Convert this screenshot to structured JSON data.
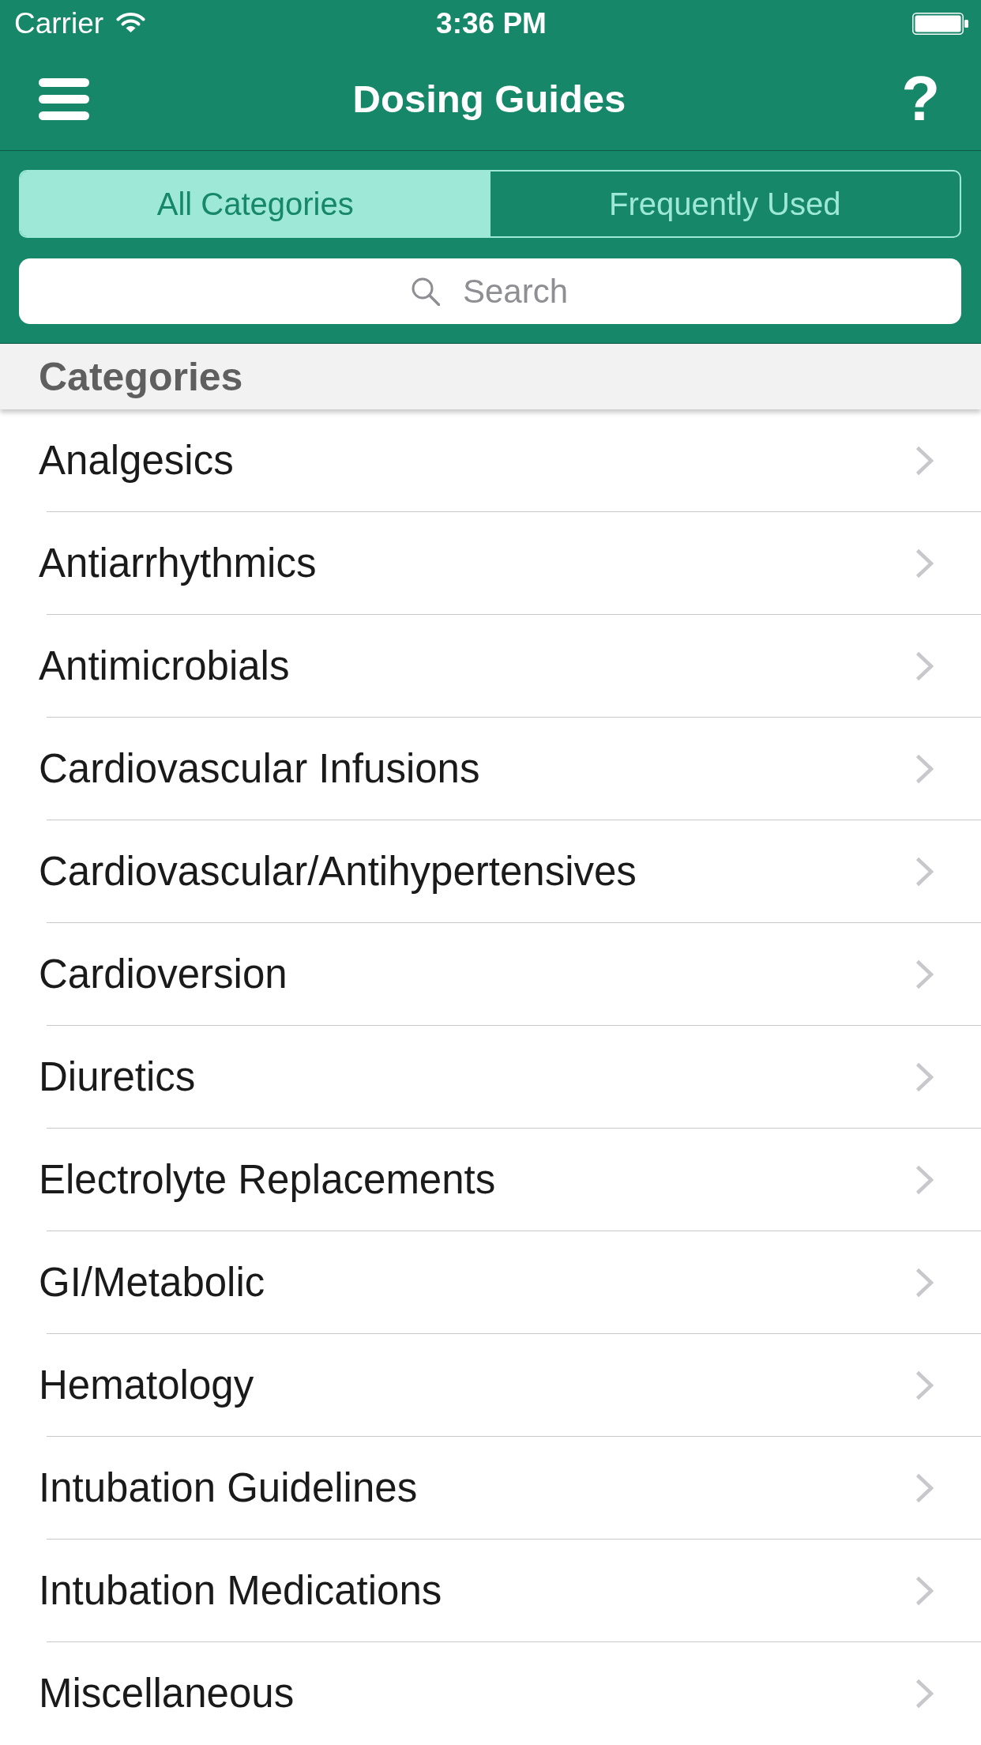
{
  "status_bar": {
    "carrier": "Carrier",
    "time": "3:36 PM"
  },
  "nav_bar": {
    "title": "Dosing Guides",
    "help_button": "?"
  },
  "tabs": [
    {
      "label": "All Categories",
      "selected": true
    },
    {
      "label": "Frequently Used",
      "selected": false
    }
  ],
  "search": {
    "placeholder": "Search"
  },
  "section": {
    "title": "Categories"
  },
  "categories": [
    "Analgesics",
    "Antiarrhythmics",
    "Antimicrobials",
    "Cardiovascular Infusions",
    "Cardiovascular/Antihypertensives",
    "Cardioversion",
    "Diuretics",
    "Electrolyte Replacements",
    "GI/Metabolic",
    "Hematology",
    "Intubation Guidelines",
    "Intubation Medications",
    "Miscellaneous"
  ]
}
